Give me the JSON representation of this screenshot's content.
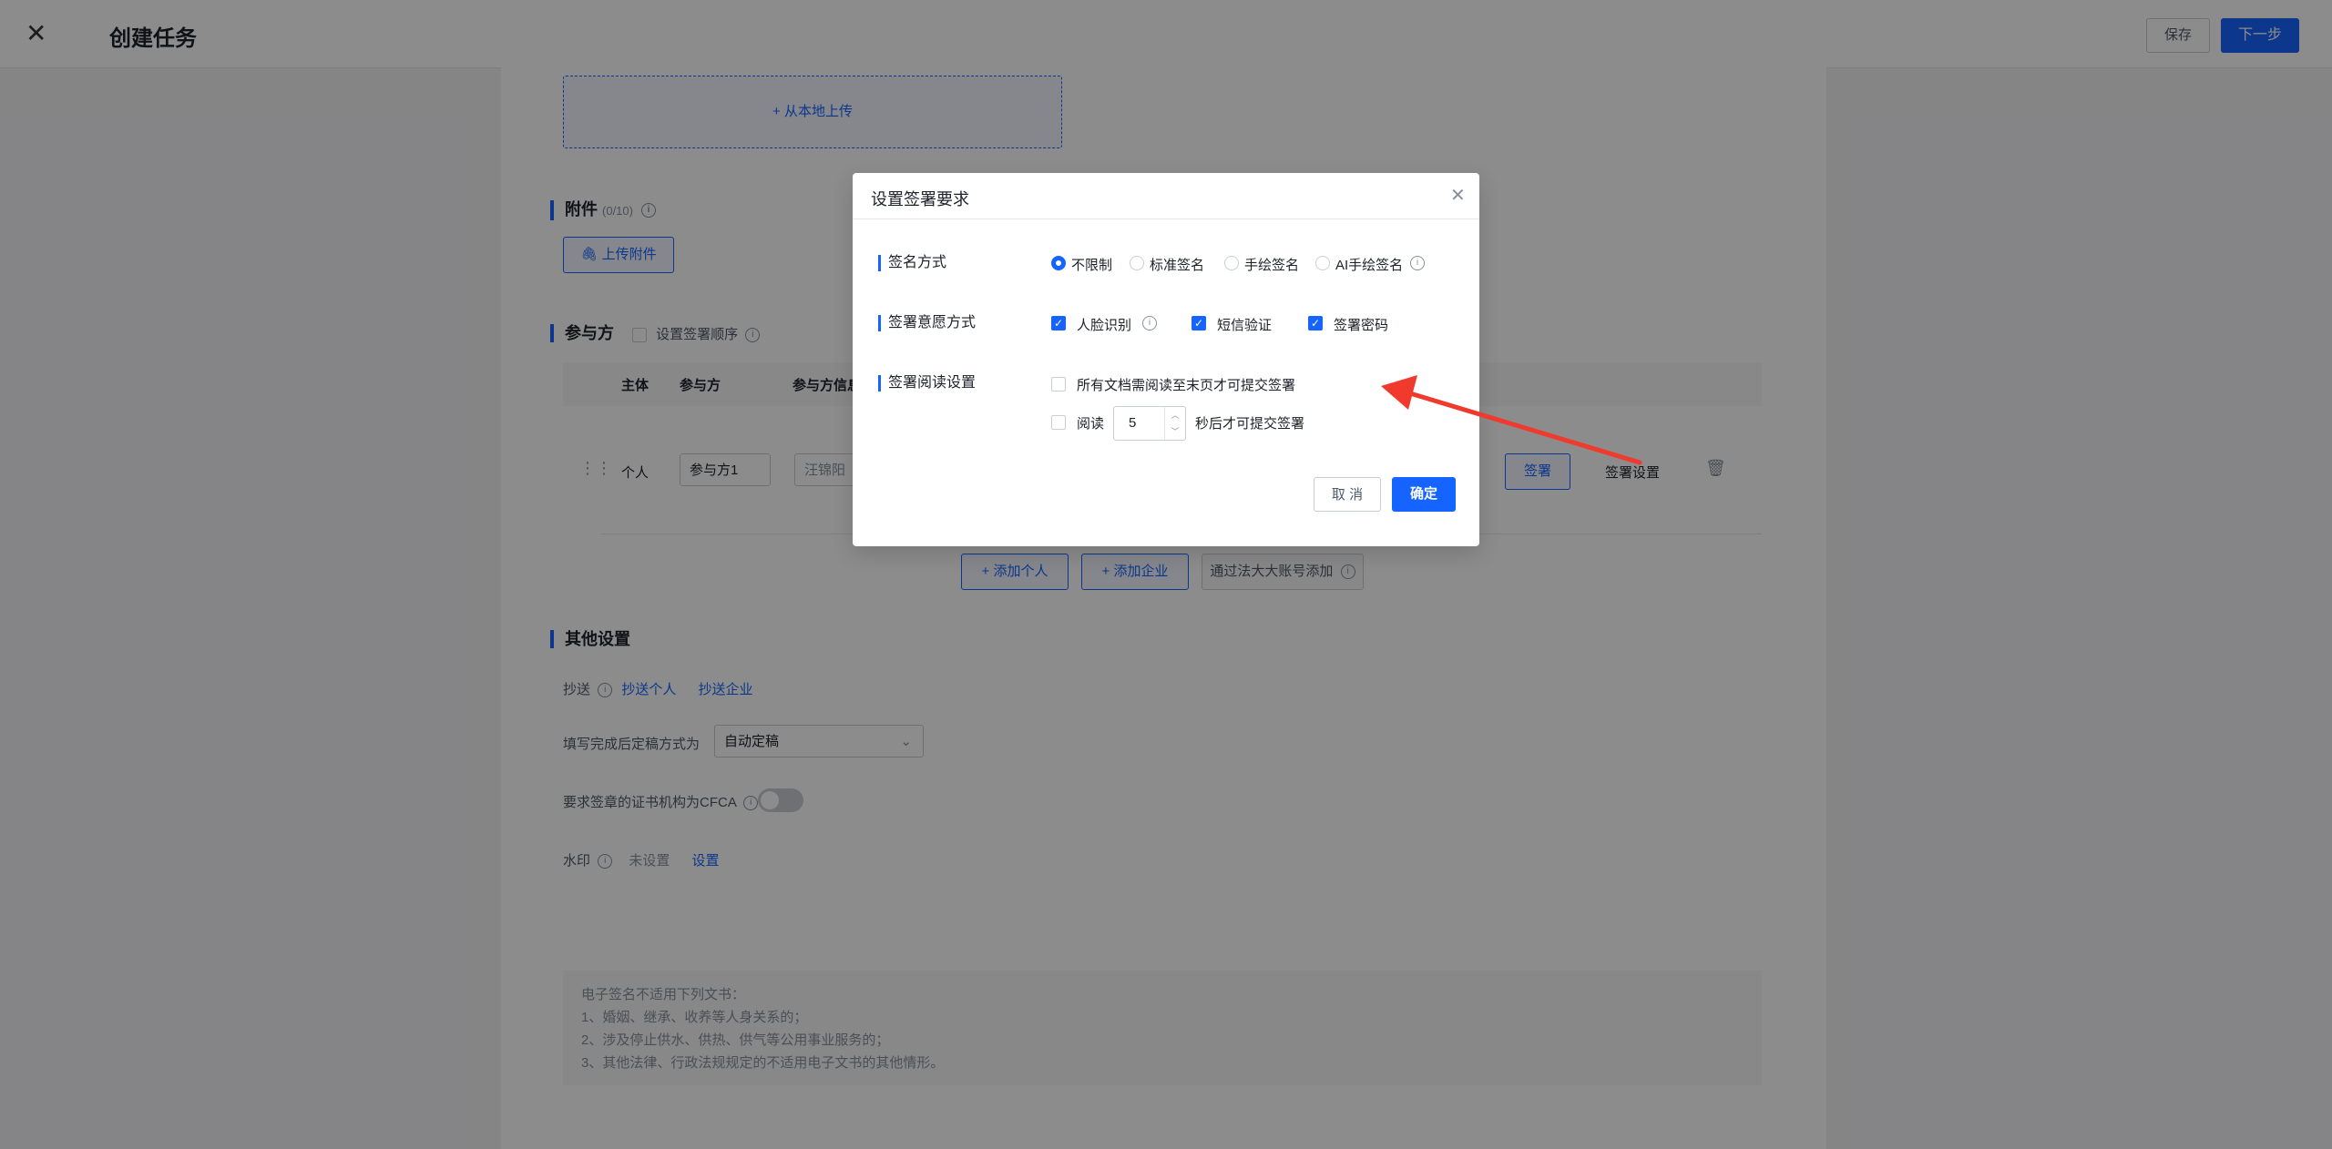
{
  "header": {
    "title": "创建任务",
    "save_label": "保存",
    "next_label": "下一步"
  },
  "upload": {
    "local_upload_label": "+ 从本地上传"
  },
  "attachments": {
    "title": "附件",
    "count": "(0/10)",
    "upload_button": "上传附件"
  },
  "participants": {
    "title": "参与方",
    "set_order_label": "设置签署顺序",
    "columns": [
      "主体",
      "参与方",
      "参与方信息"
    ],
    "row": {
      "subject": "个人",
      "name": "参与方1",
      "info_placeholder": "汪锦阳",
      "sign_label": "签署",
      "settings_link": "签署设置"
    },
    "add_person": "+ 添加个人",
    "add_company": "+ 添加企业",
    "add_via_account": "通过法大大账号添加"
  },
  "other_settings": {
    "title": "其他设置",
    "cc_label": "抄送",
    "cc_person": "抄送个人",
    "cc_company": "抄送企业",
    "finalize_label": "填写完成后定稿方式为",
    "finalize_value": "自动定稿",
    "cfca_label": "要求签章的证书机构为CFCA",
    "watermark_label": "水印",
    "watermark_status": "未设置",
    "watermark_link": "设置"
  },
  "notice": {
    "lines": [
      "电子签名不适用下列文书：",
      "1、婚姻、继承、收养等人身关系的；",
      "2、涉及停止供水、供热、供气等公用事业服务的；",
      "3、其他法律、行政法规规定的不适用电子文书的其他情形。"
    ]
  },
  "modal": {
    "title": "设置签署要求",
    "sign_method_label": "签名方式",
    "sign_methods": [
      "不限制",
      "标准签名",
      "手绘签名",
      "AI手绘签名"
    ],
    "sign_method_selected": 0,
    "intent_label": "签署意愿方式",
    "intent_options": [
      "人脸识别",
      "短信验证",
      "签署密码"
    ],
    "intent_checked": [
      true,
      true,
      true
    ],
    "read_label": "签署阅读设置",
    "read_option_1": "所有文档需阅读至末页才可提交签署",
    "read_option_2_prefix": "阅读",
    "read_seconds": "5",
    "read_option_2_suffix": "秒后才可提交签署",
    "cancel_label": "取 消",
    "ok_label": "确定"
  },
  "colors": {
    "primary": "#1664ff",
    "arrow": "#f03a2e"
  }
}
